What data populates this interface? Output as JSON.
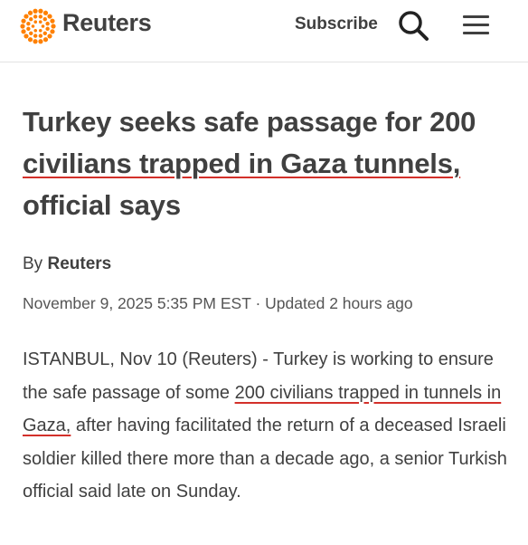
{
  "header": {
    "brand": "Reuters",
    "subscribe_label": "Subscribe",
    "search_icon": "search-icon",
    "menu_icon": "hamburger-menu-icon",
    "brand_color": "#ff8000"
  },
  "article": {
    "headline_part1": "Turkey seeks safe passage for 200 ",
    "headline_part2": "civilians trapped in Gaza tunnels,",
    "headline_part3": " official says",
    "byline_prefix": "By",
    "byline_author": "Reuters",
    "date": "November 9, 2025 5:35 PM EST",
    "separator": "·",
    "updated": "Updated 2 hours ago",
    "body_part1": "ISTANBUL, Nov 10 (Reuters) - Turkey is working to ensure the safe passage of some ",
    "body_link": "200 civilians trapped in tunnels in Gaza,",
    "body_part2": " after having facilitated the return of a deceased Israeli soldier killed there more than a decade ago, a senior Turkish official said late on Sunday."
  },
  "colors": {
    "text": "#404040",
    "annotation_underline": "#d3302a"
  }
}
